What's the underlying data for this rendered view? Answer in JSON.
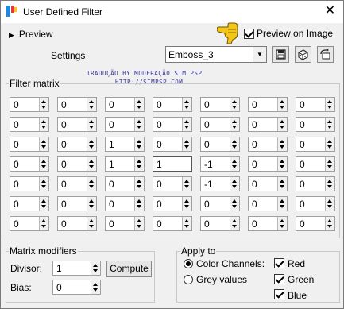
{
  "window": {
    "title": "User Defined Filter",
    "close_glyph": "✕"
  },
  "preview": {
    "label": "Preview",
    "preview_on_image_label": "Preview on Image",
    "preview_on_image_checked": true
  },
  "settings": {
    "label": "Settings",
    "preset": "Emboss_3"
  },
  "credit": {
    "line1": "TRADUÇÃO BY MODERAÇÃO SIM PSP",
    "line2": "HTTP://SIMPSP.COM"
  },
  "matrix": {
    "title": "Filter matrix",
    "rows": [
      [
        "0",
        "0",
        "0",
        "0",
        "0",
        "0",
        "0"
      ],
      [
        "0",
        "0",
        "0",
        "0",
        "0",
        "0",
        "0"
      ],
      [
        "0",
        "0",
        "1",
        "0",
        "0",
        "0",
        "0"
      ],
      [
        "0",
        "0",
        "1",
        "1",
        "-1",
        "0",
        "0"
      ],
      [
        "0",
        "0",
        "0",
        "0",
        "-1",
        "0",
        "0"
      ],
      [
        "0",
        "0",
        "0",
        "0",
        "0",
        "0",
        "0"
      ],
      [
        "0",
        "0",
        "0",
        "0",
        "0",
        "0",
        "0"
      ]
    ]
  },
  "modifiers": {
    "title": "Matrix modifiers",
    "divisor_label": "Divisor:",
    "divisor": "1",
    "compute_label": "Compute",
    "bias_label": "Bias:",
    "bias": "0"
  },
  "apply_to": {
    "title": "Apply to",
    "color_channels_label": "Color Channels:",
    "color_channels_selected": true,
    "grey_values_label": "Grey values",
    "red_label": "Red",
    "green_label": "Green",
    "blue_label": "Blue"
  }
}
